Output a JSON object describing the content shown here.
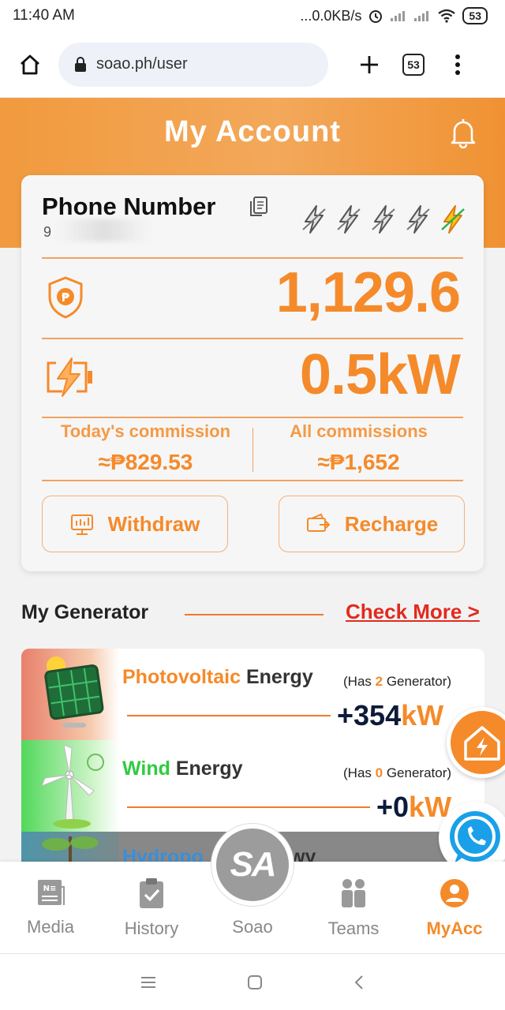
{
  "status_bar": {
    "time": "11:40 AM",
    "network": "...0.0KB/s",
    "battery": "53"
  },
  "browser": {
    "url": "soao.ph/user",
    "tab_count": "53"
  },
  "header": {
    "title": "My Account"
  },
  "account": {
    "label": "Phone Number",
    "phone_number": "9",
    "balance": "1,129.6",
    "power": "0.5kW",
    "today_commission_label": "Today's commission",
    "today_commission_value": "≈₱829.53",
    "all_commissions_label": "All commissions",
    "all_commissions_value": "≈₱1,652",
    "withdraw_label": "Withdraw",
    "recharge_label": "Recharge",
    "level_bolts_total": 5,
    "level_bolts_active": 1
  },
  "generator_section": {
    "title": "My Generator",
    "check_more": "Check More >",
    "items": [
      {
        "name_colored": "Photovoltaic",
        "name_plain": "Energy",
        "has_prefix": "(Has ",
        "has_count": "2",
        "has_suffix": " Generator)",
        "power": "+354",
        "unit": "kW",
        "color": "#f58a2a"
      },
      {
        "name_colored": "Wind",
        "name_plain": "Energy",
        "has_prefix": "(Has ",
        "has_count": "0",
        "has_suffix": " Generator)",
        "power": "+0",
        "unit": "kW",
        "color": "#2ecc40"
      },
      {
        "name_colored": "Hydropo",
        "name_plain": "wy",
        "has_prefix": "",
        "has_count": "",
        "has_suffix": "",
        "power": "",
        "unit": "",
        "color": "#3a8fd8"
      }
    ]
  },
  "bottom_nav": {
    "items": [
      "Media",
      "History",
      "Soao",
      "Teams",
      "MyAcc"
    ],
    "active": "MyAcc",
    "center_logo": "SA"
  },
  "colors": {
    "accent": "#f58a2a",
    "link_red": "#e22a1e"
  }
}
